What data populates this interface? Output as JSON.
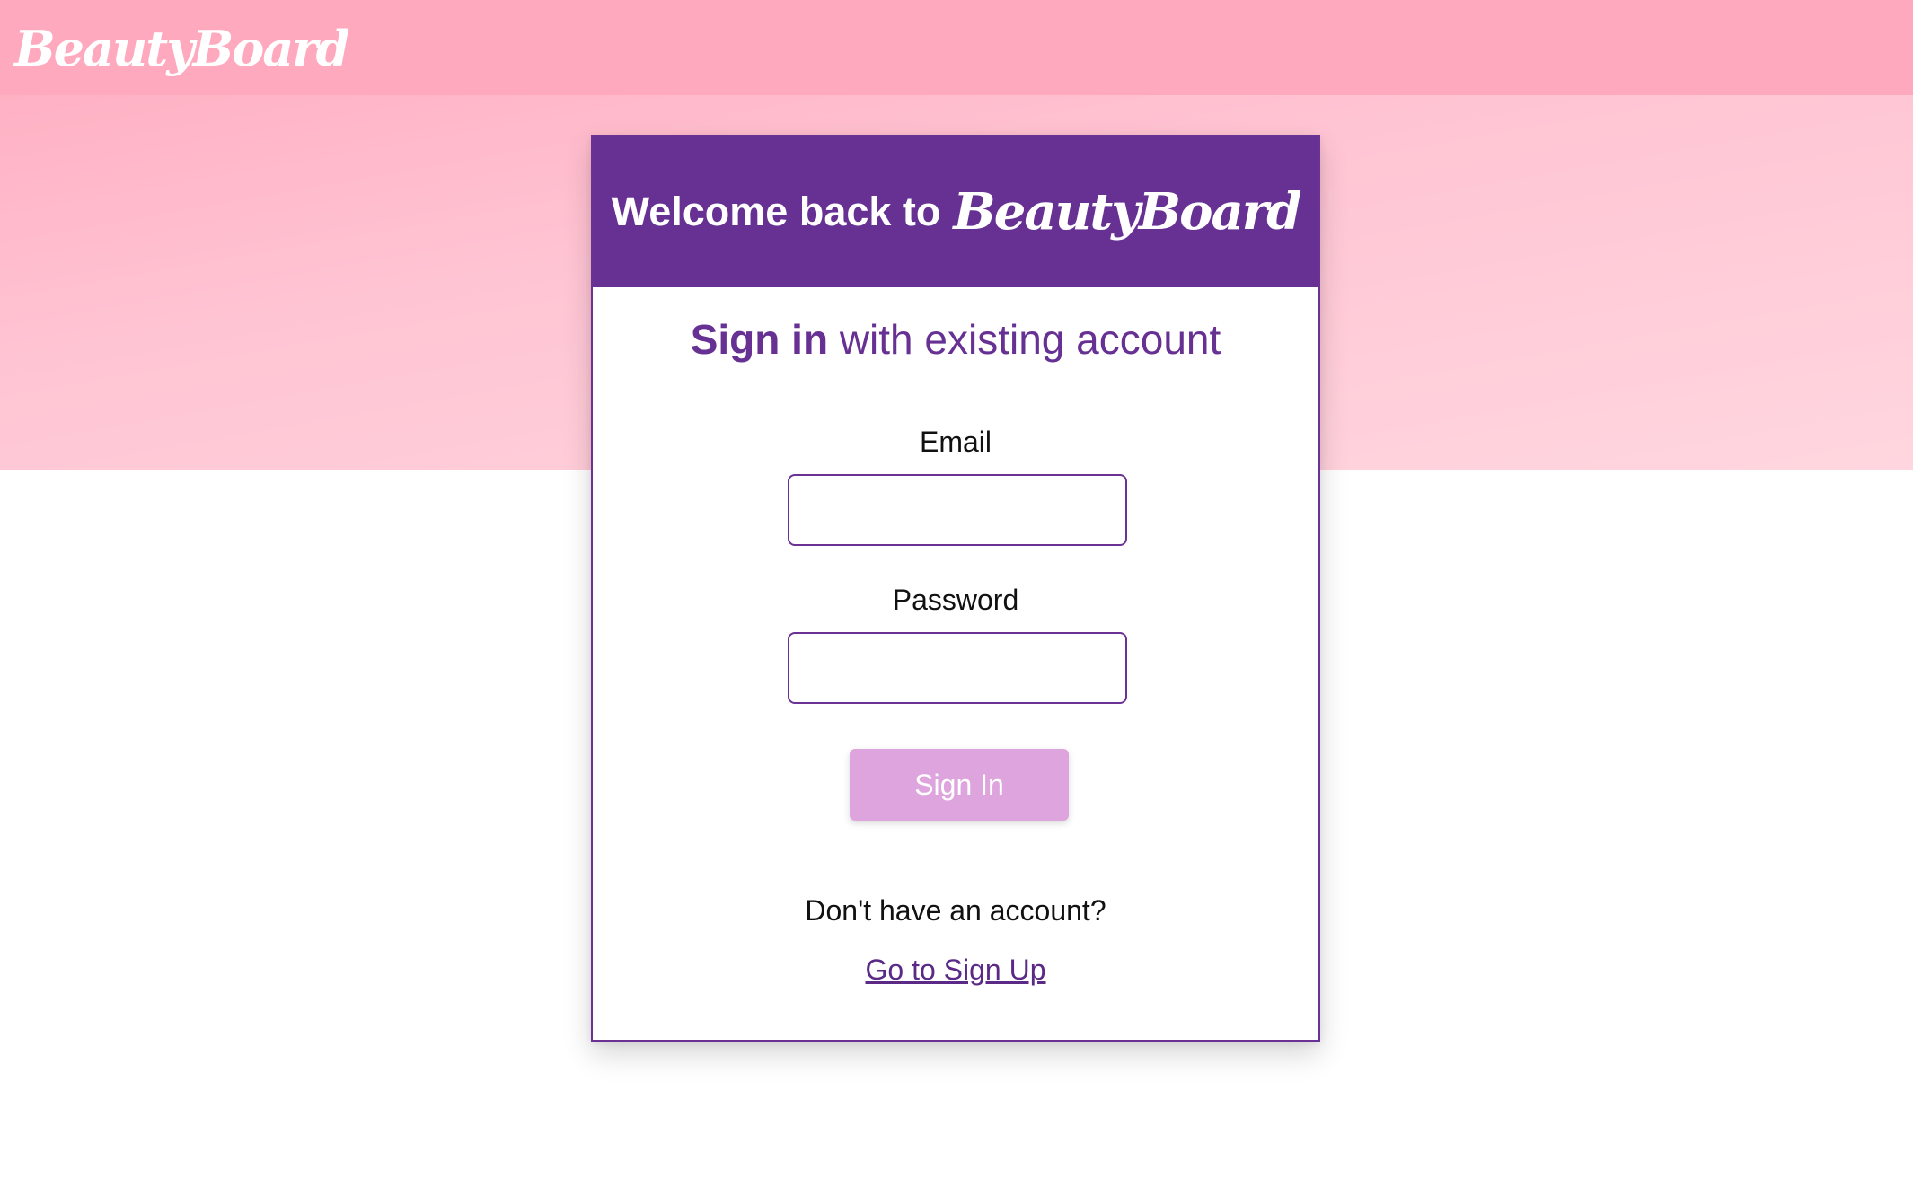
{
  "topbar": {
    "brand": "BeautyBoard"
  },
  "card": {
    "welcome_prefix": "Welcome back to",
    "welcome_brand": "BeautyBoard",
    "subheading_bold": "Sign in",
    "subheading_rest": " with existing account",
    "email_label": "Email",
    "email_value": "",
    "password_label": "Password",
    "password_value": "",
    "signin_button": "Sign In",
    "no_account_text": "Don't have an account?",
    "signup_link": "Go to Sign Up"
  },
  "colors": {
    "primary_purple": "#673194",
    "pink_band": "#ffaabf",
    "button_disabled_pink": "#dea4dd"
  }
}
